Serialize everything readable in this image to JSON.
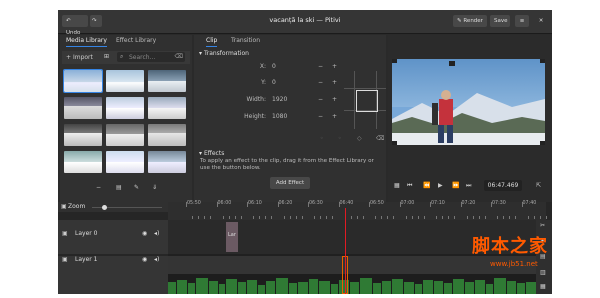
{
  "header": {
    "undo": "Undo",
    "title": "vacanță la ski — Pitivi",
    "render": "Render",
    "save": "Save"
  },
  "library": {
    "tabs": [
      "Media Library",
      "Effect Library"
    ],
    "import": "Import",
    "search_placeholder": "Search..."
  },
  "clip_panel": {
    "tabs": [
      "Clip",
      "Transition"
    ],
    "transformation": "Transformation",
    "fields": [
      {
        "label": "X:",
        "value": "0"
      },
      {
        "label": "Y:",
        "value": "0"
      },
      {
        "label": "Width:",
        "value": "1920"
      },
      {
        "label": "Height:",
        "value": "1080"
      }
    ],
    "effects": "Effects",
    "effects_text": "To apply an effect to the clip, drag it from the Effect Library or use the button below.",
    "add_effect": "Add Effect"
  },
  "viewer": {
    "time": "06:47.469"
  },
  "timeline": {
    "zoom": "Zoom",
    "ruler": [
      "05:50",
      "06:00",
      "06:10",
      "06:20",
      "06:30",
      "06:40",
      "06:50",
      "07:00",
      "07:10",
      "07:20",
      "07:30",
      "07:40"
    ],
    "layers": [
      "Layer 0",
      "Layer 1"
    ],
    "clip_label": "Lar"
  },
  "watermark": {
    "cn": "脚本之家",
    "url": "www.jb51.net"
  },
  "colors": {
    "accent": "#3584e4",
    "playhead": "#e01b24",
    "audio": "#2f7a34"
  }
}
